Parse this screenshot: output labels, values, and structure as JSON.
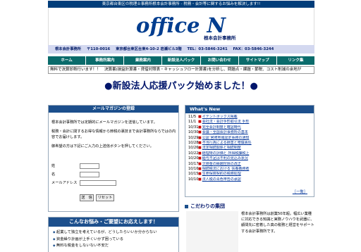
{
  "top_banner": "東京都台東区の税理士事務所根本会計事務所 - 税務・会計等に関するお悩みを解決します!!",
  "logo": {
    "title": "office N",
    "subtitle": "根本会計事務所"
  },
  "address_bar": {
    "name": "根本会計事務所",
    "postal": "〒110-0016",
    "address": "東京都台東区台東4-10-2 岩瀬ビル3階",
    "tel": "TEL：03-5846-3241",
    "fax": "FAX：03-5846-3244"
  },
  "nav": [
    {
      "label": "ホーム"
    },
    {
      "label": "事務所案内"
    },
    {
      "label": "業務案内"
    },
    {
      "label": "新設法人パック"
    },
    {
      "label": "お問い合わせ"
    },
    {
      "label": "サイトマップ"
    },
    {
      "label": "リンク集"
    }
  ],
  "ticker": "無料で決算診断行います！！　決算書(損益計算書・貸借対照表・キャッシュフロー計算書)を分析し、問題点・課題・節税、コスト削減の余地が",
  "headline": {
    "bullet_left": "●",
    "text": "新設法人応援パック始めました！",
    "bullet_right": "●"
  },
  "mail_magazine": {
    "title": "メールマガジンの登録",
    "paragraphs": [
      "根本会計事務所では定期的にメールマガジンを送信しています。",
      "税務・会計に関するお得な情報から節税の裏技まで会計事務所ならではの内容でお届けします。",
      "御希望の方は下記にご入力の上送信ボタンを押してください。"
    ],
    "fields": [
      {
        "label": "姓"
      },
      {
        "label": "名"
      },
      {
        "label": "メールアドレス"
      }
    ],
    "submit_label": "送　信",
    "reset_label": "リセット"
  },
  "consult": {
    "title": "こんなお悩み・ご要望にお応えします！",
    "items": [
      "起業して独立を考えているが、どうしたらいいか分からない",
      "資金繰り計画が上手くいかず困っている",
      "無料な税金をしないない不安だ"
    ]
  },
  "whats_new": {
    "title": "What's New",
    "items": [
      {
        "date": "11/5",
        "text": "イデントボックス掲載"
      },
      {
        "date": "11/1",
        "text": "会社法・会計手形取引法 手形"
      },
      {
        "date": "10/31",
        "text": "完全会計制度と確認時代"
      },
      {
        "date": "10/30",
        "text": "会議・全国会計事務所の基本"
      },
      {
        "date": "10/29",
        "text": "公認 宮崎地域認定事務の通知"
      },
      {
        "date": "10/28",
        "text": "不当行為による損害と賠償責任"
      },
      {
        "date": "10/26",
        "text": "法定相続関係と相続制度"
      },
      {
        "date": "10/22",
        "text": "経理特の評価と 所得税課税上"
      },
      {
        "date": "10/20",
        "text": "給与不足は不利の見込み状況"
      },
      {
        "date": "10/17",
        "text": "欠損金の繰越控除の改正"
      },
      {
        "date": "10/16",
        "text": "相続税法における 扶養義務者"
      },
      {
        "date": "10/15",
        "text": "生命保険契約の税務処理"
      },
      {
        "date": "10/10",
        "text": "法人税の青色申告の承認"
      }
    ],
    "more_label": "［一覧］"
  },
  "kodawari": {
    "title": "こだわりの集団",
    "text": "根本会計事務所は創業50年超。幅広い業種に対応できる知識と実務ノウハウを武器に、顧問先に密着した真の税務と経営をサポートする会計事務所です。"
  }
}
